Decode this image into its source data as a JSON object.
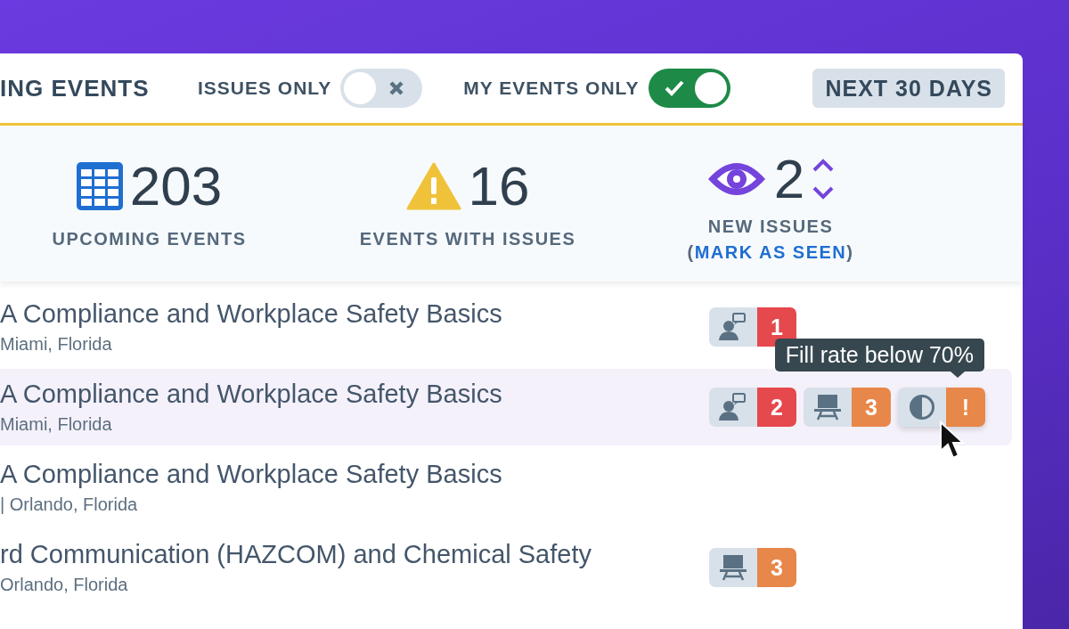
{
  "header": {
    "title": "ING EVENTS",
    "toggles": [
      {
        "label": "ISSUES ONLY",
        "on": false
      },
      {
        "label": "MY EVENTS ONLY",
        "on": true
      }
    ],
    "range_button": "NEXT 30 DAYS"
  },
  "stats": [
    {
      "kind": "calendar",
      "value": "203",
      "label": "UPCOMING EVENTS"
    },
    {
      "kind": "warning",
      "value": "16",
      "label": "EVENTS WITH ISSUES"
    },
    {
      "kind": "eye",
      "value": "2",
      "label": "NEW ISSUES",
      "link_prefix": "(",
      "link": "MARK AS SEEN",
      "link_suffix": ")"
    }
  ],
  "events": [
    {
      "title": "A Compliance and Workplace Safety Basics",
      "subtitle": "Miami, Florida",
      "selected": false,
      "badges": [
        {
          "kind": "instructor",
          "count": "1",
          "color": "#e5484d"
        }
      ]
    },
    {
      "title": "A Compliance and Workplace Safety Basics",
      "subtitle": "Miami, Florida",
      "selected": true,
      "badges": [
        {
          "kind": "instructor",
          "count": "2",
          "color": "#e5484d"
        },
        {
          "kind": "classroom",
          "count": "3",
          "color": "#e8874a"
        },
        {
          "kind": "fill",
          "count": "!",
          "color": "#e8874a",
          "tooltip": "Fill rate below 70%"
        }
      ]
    },
    {
      "title": "A Compliance and Workplace Safety Basics",
      "subtitle": "| Orlando, Florida",
      "selected": false
    },
    {
      "title": "rd Communication (HAZCOM) and Chemical Safety",
      "subtitle": "Orlando, Florida",
      "selected": false,
      "badges": [
        {
          "kind": "classroom",
          "count": "3",
          "color": "#e8874a"
        }
      ]
    }
  ]
}
